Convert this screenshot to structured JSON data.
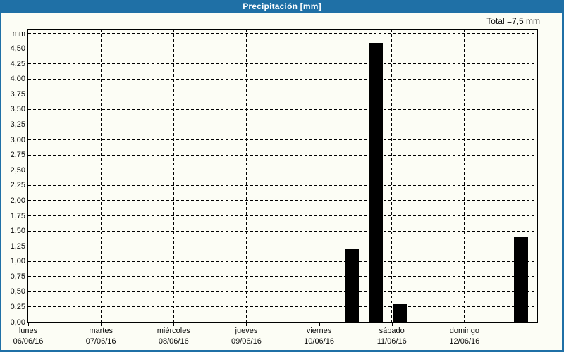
{
  "header": {
    "title": "Precipitación [mm]"
  },
  "summary": {
    "total_label": "Total =7,5 mm"
  },
  "colors": {
    "accent_blue": "#1f70a6",
    "background": "#fcfdf5",
    "bar": "#000000",
    "grid": "#000000",
    "title_text": "#ffffff"
  },
  "chart_data": {
    "type": "bar",
    "title": "Precipitación [mm]",
    "ylabel": "mm",
    "xlabel": "",
    "total_label": "Total =7,5 mm",
    "total_mm": 7.5,
    "ylim": [
      0,
      4.82
    ],
    "ytick_step_mm": 0.25,
    "ytick_labels": [
      "0,00",
      "0,25",
      "0,50",
      "0,75",
      "1,00",
      "1,25",
      "1,50",
      "1,75",
      "2,00",
      "2,25",
      "2,50",
      "2,75",
      "3,00",
      "3,25",
      "3,50",
      "3,75",
      "4,00",
      "4,25",
      "4,50"
    ],
    "grid": {
      "horizontal": "dashed every 0,25 mm",
      "vertical": "dashed at each day boundary"
    },
    "legend": "none",
    "x_categories": [
      {
        "day": "lunes",
        "date": "06/06/16"
      },
      {
        "day": "martes",
        "date": "07/06/16"
      },
      {
        "day": "miércoles",
        "date": "08/06/16"
      },
      {
        "day": "jueves",
        "date": "09/06/16"
      },
      {
        "day": "viernes",
        "date": "10/06/16"
      },
      {
        "day": "sábado",
        "date": "11/06/16"
      },
      {
        "day": "domingo",
        "date": "12/06/16"
      }
    ],
    "bars": [
      {
        "day": "viernes",
        "date": "10/06/16",
        "value_mm": 1.2,
        "x_frac": 0.636
      },
      {
        "day": "viernes",
        "date": "10/06/16",
        "value_mm": 4.6,
        "x_frac": 0.683
      },
      {
        "day": "sábado",
        "date": "11/06/16",
        "value_mm": 0.3,
        "x_frac": 0.731
      },
      {
        "day": "domingo",
        "date": "12/06/16",
        "value_mm": 1.4,
        "x_frac": 0.968
      }
    ]
  }
}
